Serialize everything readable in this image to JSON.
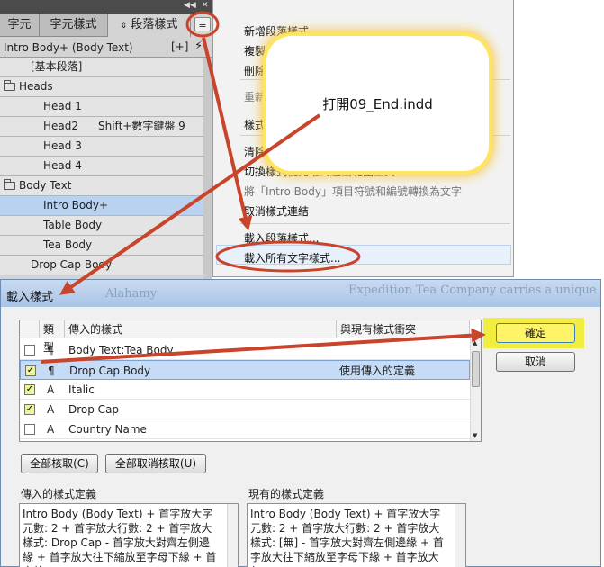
{
  "panel": {
    "tabs": [
      "字元",
      "字元樣式",
      "段落樣式"
    ],
    "current_style": "Intro Body+ (Body Text)",
    "new_from_selection": "[+]",
    "styles": [
      {
        "label": "[基本段落]",
        "indent": 1,
        "folder": false,
        "shortcut": ""
      },
      {
        "label": "Heads",
        "indent": 0,
        "folder": true,
        "shortcut": ""
      },
      {
        "label": "Head 1",
        "indent": 2,
        "folder": false,
        "shortcut": ""
      },
      {
        "label": "Head2",
        "indent": 2,
        "folder": false,
        "shortcut": "Shift+數字鍵盤 9"
      },
      {
        "label": "Head 3",
        "indent": 2,
        "folder": false,
        "shortcut": ""
      },
      {
        "label": "Head 4",
        "indent": 2,
        "folder": false,
        "shortcut": ""
      },
      {
        "label": "Body Text",
        "indent": 0,
        "folder": true,
        "shortcut": ""
      },
      {
        "label": "Intro Body+",
        "indent": 2,
        "folder": false,
        "shortcut": "",
        "selected": true
      },
      {
        "label": "Table Body",
        "indent": 2,
        "folder": false,
        "shortcut": ""
      },
      {
        "label": "Tea Body",
        "indent": 2,
        "folder": false,
        "shortcut": ""
      },
      {
        "label": "Drop Cap Body",
        "indent": 1,
        "folder": false,
        "shortcut": ""
      }
    ]
  },
  "menu": {
    "items": [
      {
        "label": "新增段落樣式...",
        "dim": false
      },
      {
        "label": "複製",
        "dim": false
      },
      {
        "label": "刪除",
        "dim": false
      },
      {
        "label": "重新",
        "dim": true
      },
      {
        "label": "樣式",
        "dim": false
      },
      {
        "label": "清除",
        "dim": false
      },
      {
        "label": "切換樣式優先權到超出範圍上頁",
        "dim": false
      },
      {
        "label": "將「Intro Body」項目符號和編號轉換為文字",
        "dim": true
      },
      {
        "label": "取消樣式連結",
        "dim": false
      },
      {
        "label": "載入段落樣式...",
        "dim": false
      },
      {
        "label": "載入所有文字樣式...",
        "dim": false
      }
    ]
  },
  "callout": {
    "text": "打開09_End.indd"
  },
  "dialog": {
    "title": "載入樣式",
    "bg_text_1": "Alahamy",
    "bg_text_2": "Expedition Tea Company carries a unique",
    "headers": {
      "type": "類型",
      "incoming": "傳入的樣式",
      "conflict": "與現有樣式衝突"
    },
    "rows": [
      {
        "checked": false,
        "type": "¶",
        "name": "Body Text:Tea Body",
        "conflict": ""
      },
      {
        "checked": true,
        "type": "¶",
        "name": "Drop Cap Body",
        "conflict": "使用傳入的定義",
        "selected": true
      },
      {
        "checked": true,
        "type": "A",
        "name": "Italic",
        "conflict": ""
      },
      {
        "checked": true,
        "type": "A",
        "name": "Drop Cap",
        "conflict": ""
      },
      {
        "checked": false,
        "type": "A",
        "name": "Country Name",
        "conflict": ""
      }
    ],
    "ok_label": "確定",
    "cancel_label": "取消",
    "check_all_label": "全部核取(C)",
    "uncheck_all_label": "全部取消核取(U)",
    "incoming_def_label": "傳入的樣式定義",
    "existing_def_label": "現有的樣式定義",
    "incoming_def": "Intro Body (Body Text) + 首字放大字元數: 2 + 首字放大行數: 2 + 首字放大樣式: Drop Cap - 首字放大對齊左側邊緣 + 首字放大往下縮放至字母下緣 + 首字放",
    "existing_def": "Intro Body (Body Text) + 首字放大字元數: 2 + 首字放大行數: 2 + 首字放大樣式: [無] - 首字放大對齊左側邊緣 + 首字放大往下縮放至字母下緣 + 首字放大忽"
  },
  "colors": {
    "annotation_arrow": "#c8442b",
    "highlight": "#f2ee40",
    "selection": "#b9d2ef"
  }
}
